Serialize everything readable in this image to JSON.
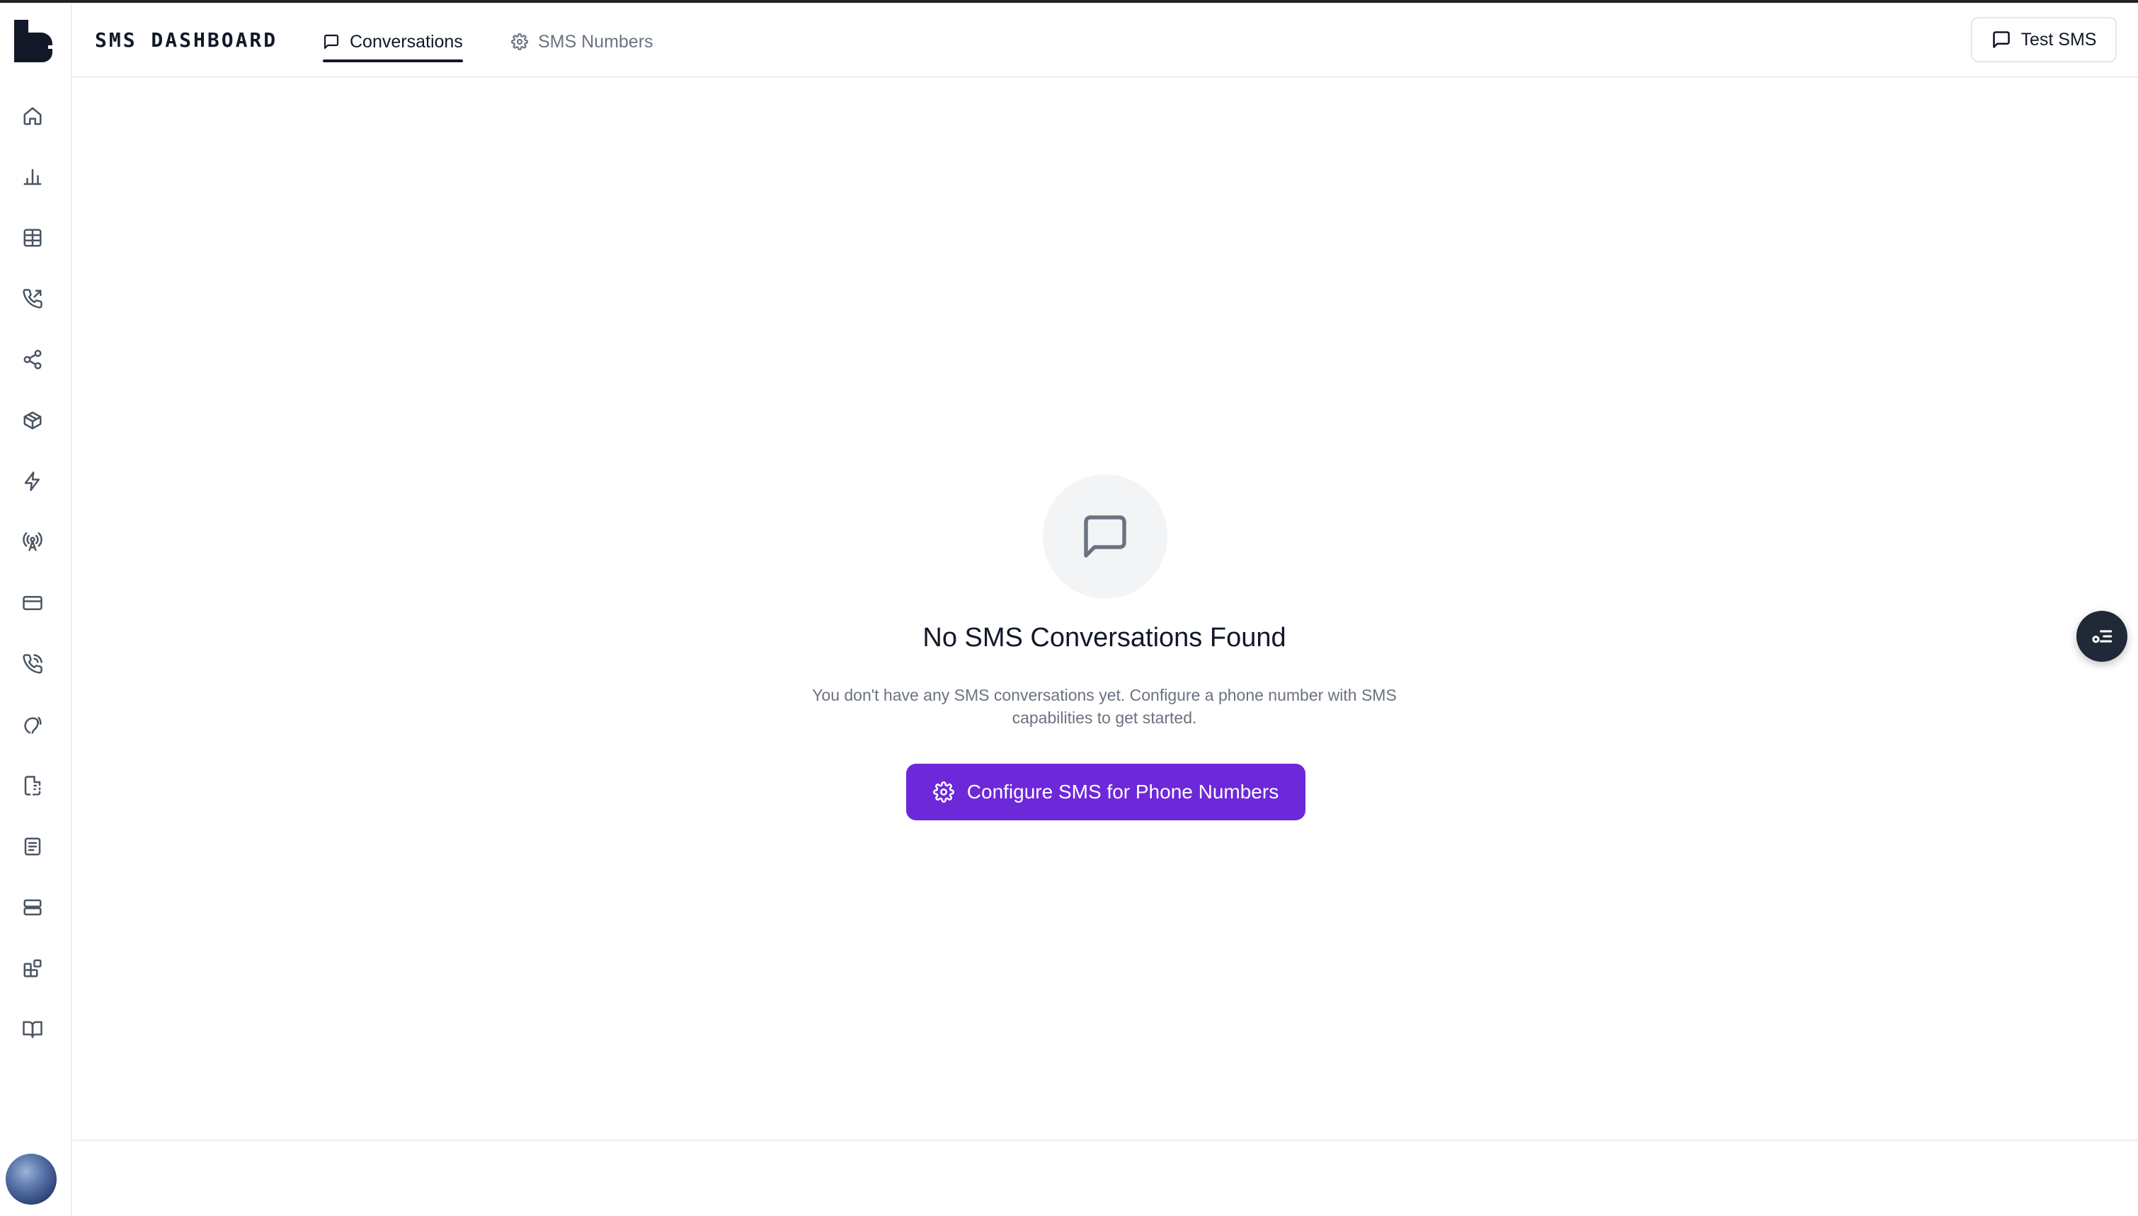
{
  "header": {
    "app_title": "SMS DASHBOARD",
    "tabs": [
      {
        "label": "Conversations",
        "icon": "message-square-icon",
        "active": true
      },
      {
        "label": "SMS Numbers",
        "icon": "gear-icon",
        "active": false
      }
    ],
    "test_button_label": "Test SMS"
  },
  "sidebar": {
    "items": [
      {
        "icon": "home-icon"
      },
      {
        "icon": "bar-chart-icon"
      },
      {
        "icon": "table-icon"
      },
      {
        "icon": "phone-outgoing-icon"
      },
      {
        "icon": "share-icon"
      },
      {
        "icon": "package-icon"
      },
      {
        "icon": "zap-icon"
      },
      {
        "icon": "radio-tower-icon"
      },
      {
        "icon": "credit-card-icon"
      },
      {
        "icon": "phone-call-icon"
      },
      {
        "icon": "speech-icon"
      },
      {
        "icon": "file-dashed-icon"
      },
      {
        "icon": "sticky-note-icon"
      },
      {
        "icon": "server-icon"
      },
      {
        "icon": "blocks-icon"
      },
      {
        "icon": "book-open-icon"
      }
    ]
  },
  "empty_state": {
    "title": "No SMS Conversations Found",
    "description": "You don't have any SMS conversations yet. Configure a phone number with SMS capabilities to get started.",
    "button_label": "Configure SMS for Phone Numbers"
  },
  "colors": {
    "accent": "#6d28d9",
    "text_primary": "#111827",
    "text_muted": "#6b7280",
    "border": "#eceef1"
  }
}
